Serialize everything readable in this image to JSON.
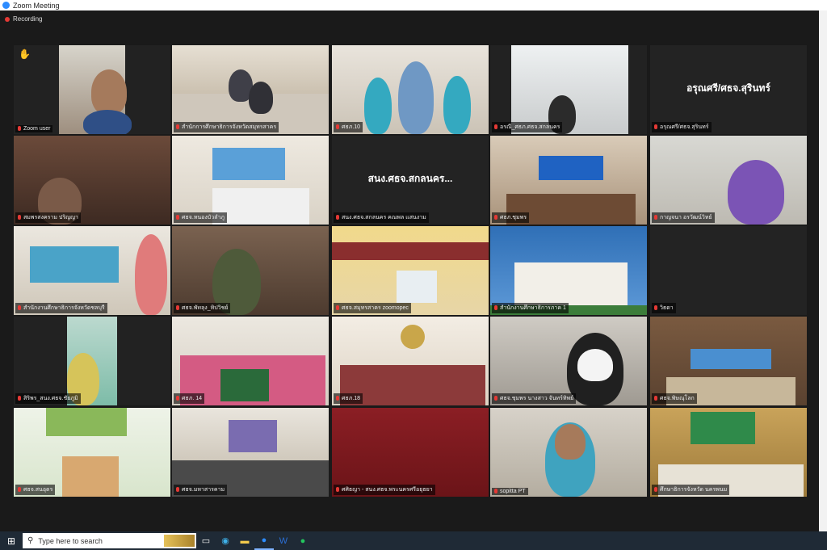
{
  "window": {
    "title": "Zoom Meeting"
  },
  "recording": {
    "label": "Recording"
  },
  "tiles": [
    {
      "label": "Zoom user"
    },
    {
      "label": "สำนักการศึกษาธิการจังหวัดสมุทรสาคร"
    },
    {
      "label": "ศธภ.10"
    },
    {
      "label": "อรณี_ศธภ.ศธจ.สกลนคร"
    },
    {
      "label": "อรุณศรี/ศธจ.สุรินทร์",
      "display_name": "อรุณศรี/ศธจ.สุรินทร์"
    },
    {
      "label": "สมพรสงคราม ปริญญา"
    },
    {
      "label": "ศธจ.หนองบัวลำภู"
    },
    {
      "label": "สนง.ศธจ.สกลนคร คณพล แสนงาม",
      "display_name": "สนง.ศธจ.สกลนคร..."
    },
    {
      "label": "ศธภ.ชุมพร"
    },
    {
      "label": "กาญจนา อรวัฒน์วิทย์"
    },
    {
      "label": "สำนักงานศึกษาธิการจังหวัดชลบุรี"
    },
    {
      "label": "ศธจ.พัทลุง_ทิปวิชย์"
    },
    {
      "label": "ศธจ.สมุทรสาคร zoomopec"
    },
    {
      "label": "สำนักงานศึกษาธิการภาค 1"
    },
    {
      "label": "วิธดา"
    },
    {
      "label": "สิริพร_สนง.ศธจ.ชัยภูมิ"
    },
    {
      "label": "ศธภ. 14"
    },
    {
      "label": "ศธภ.18"
    },
    {
      "label": "ศธจ.ชุมพร นางสาว จันทร์ทิพย์"
    },
    {
      "label": "ศธจ.พิษณุโลก"
    },
    {
      "label": "ศธจ.สนอุดร"
    },
    {
      "label": "ศธจ.มหาสารคาม"
    },
    {
      "label": "ศศิธญา - สนง.ศธจ.พระนครศรีอยุธยา"
    },
    {
      "label": "sopitta PT"
    },
    {
      "label": "ศึกษาธิการจังหวัด นครพนม"
    }
  ],
  "taskbar": {
    "search_placeholder": "Type here to search",
    "start_icon": "windows-start-icon",
    "icons": [
      "task-view-icon",
      "edge-icon",
      "file-explorer-icon",
      "zoom-icon",
      "word-icon",
      "line-icon"
    ]
  },
  "colors": {
    "active_speaker": "#c8e04a",
    "zoom_blue": "#2d8cff"
  }
}
